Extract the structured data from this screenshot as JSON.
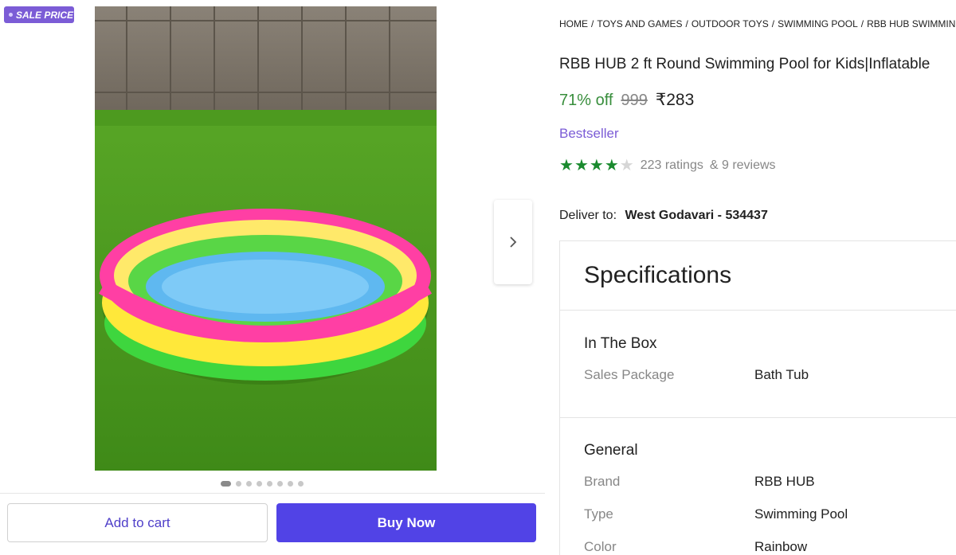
{
  "badge": {
    "label": "SALE PRICE"
  },
  "gallery": {
    "dots_count": 8,
    "active_index": 0
  },
  "breadcrumb": [
    "HOME",
    "TOYS AND GAMES",
    "OUTDOOR TOYS",
    "SWIMMING POOL",
    "RBB HUB SWIMMING"
  ],
  "product": {
    "title": "RBB HUB 2 ft Round Swimming Pool for Kids|Inflatable",
    "discount": "71% off",
    "mrp": "999",
    "price": "₹283",
    "tag": "Bestseller",
    "rating_stars": 4,
    "ratings": "223 ratings",
    "reviews": "& 9 reviews"
  },
  "delivery": {
    "label": "Deliver to:",
    "location": "West Godavari - 534437"
  },
  "specs": {
    "heading": "Specifications",
    "groups": [
      {
        "name": "In The Box",
        "rows": [
          {
            "key": "Sales Package",
            "value": "Bath Tub"
          }
        ]
      },
      {
        "name": "General",
        "rows": [
          {
            "key": "Brand",
            "value": "RBB HUB"
          },
          {
            "key": "Type",
            "value": "Swimming Pool"
          },
          {
            "key": "Color",
            "value": "Rainbow"
          }
        ]
      }
    ]
  },
  "actions": {
    "add_to_cart": "Add to cart",
    "buy_now": "Buy Now"
  },
  "colors": {
    "brand_purple": "#5143e6",
    "discount_green": "#388e3c",
    "star_green": "#1a8a2e",
    "badge_purple": "#7b5cd6"
  },
  "icons": {
    "next": "chevron-right-icon"
  }
}
